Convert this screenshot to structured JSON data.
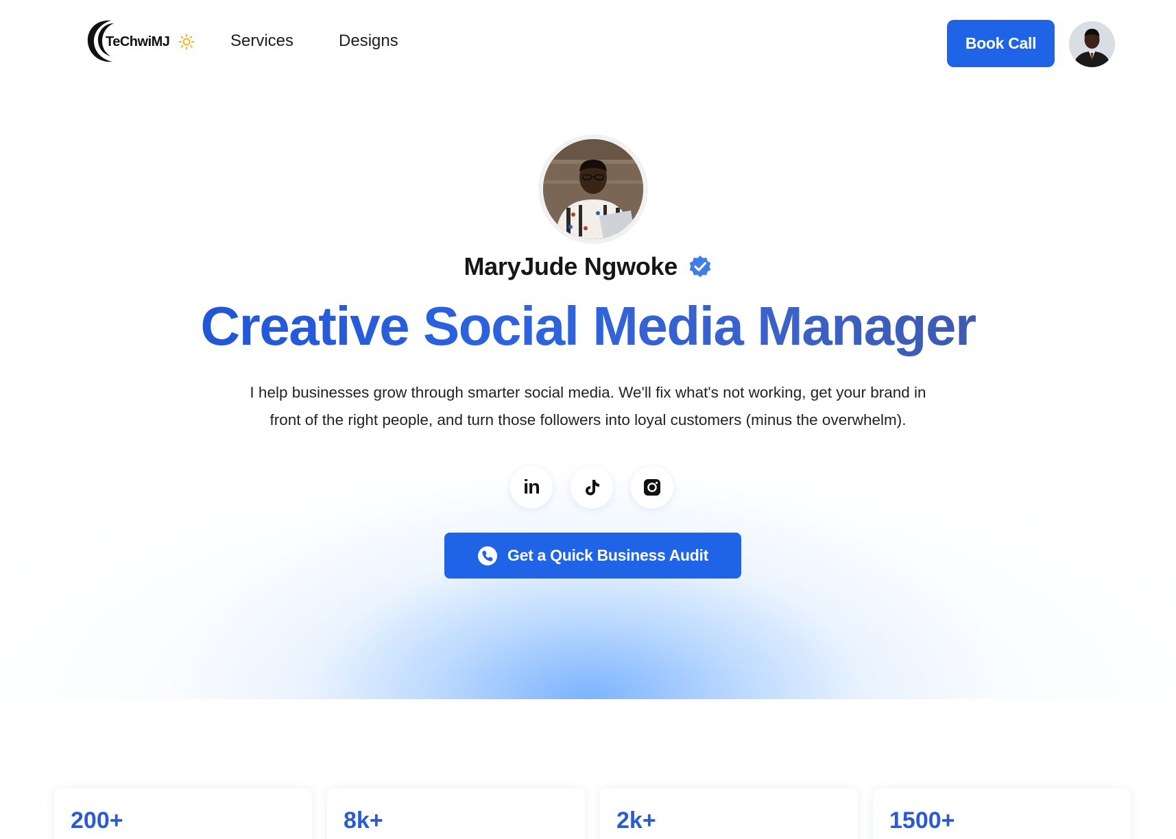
{
  "brand": {
    "logo_text": "TeChwiMJ",
    "accent_color": "#1f63e6",
    "headline_color": "#2159d8",
    "sun_color": "#f2b422"
  },
  "nav": {
    "items": [
      {
        "label": "Services"
      },
      {
        "label": "Designs"
      }
    ]
  },
  "header": {
    "book_call_label": "Book Call",
    "avatar_icon": "user-avatar"
  },
  "hero": {
    "name": "MaryJude Ngwoke",
    "verified_icon": "verified-badge-icon",
    "headline": "Creative Social Media Manager",
    "intro_line1": "I help businesses grow through smarter social media. We'll fix what's not working, get your brand in",
    "intro_line2": "front of the right people, and turn those followers into loyal customers (minus the overwhelm).",
    "socials": [
      {
        "name": "linkedin-icon",
        "glyph": "in"
      },
      {
        "name": "tiktok-icon"
      },
      {
        "name": "instagram-icon"
      }
    ],
    "cta_label": "Get a Quick Business Audit",
    "cta_icon": "phone-icon"
  },
  "stats": [
    {
      "value": "200+"
    },
    {
      "value": "8k+"
    },
    {
      "value": "2k+"
    },
    {
      "value": "1500+"
    }
  ]
}
